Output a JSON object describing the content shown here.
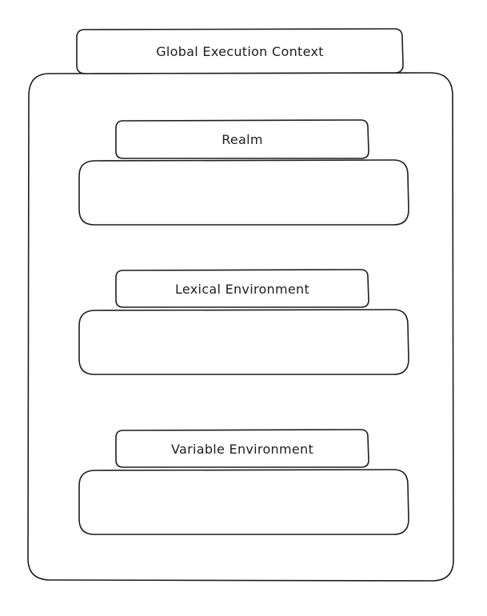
{
  "diagram": {
    "title": "Global Execution Context",
    "components": [
      {
        "label": "Realm"
      },
      {
        "label": "Lexical Environment"
      },
      {
        "label": "Variable Environment"
      }
    ]
  },
  "colors": {
    "stroke": "#1e1e1e",
    "fill": "#ffffff"
  }
}
